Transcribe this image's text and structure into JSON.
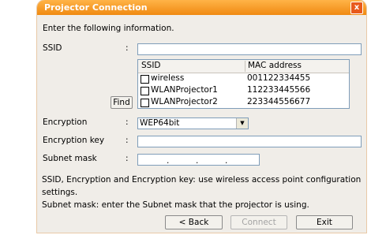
{
  "window": {
    "title": "Projector Connection",
    "close_glyph": "x"
  },
  "instruction": "Enter the following information.",
  "ssid": {
    "label": "SSID",
    "colon": ":",
    "value": ""
  },
  "network_list": {
    "headers": [
      "SSID",
      "MAC address"
    ],
    "rows": [
      {
        "ssid": "wireless",
        "mac": "001122334455",
        "checked": false
      },
      {
        "ssid": "WLANProjector1",
        "mac": "112233445566",
        "checked": false
      },
      {
        "ssid": "WLANProjector2",
        "mac": "223344556677",
        "checked": false
      }
    ]
  },
  "find_button": "Find",
  "encryption": {
    "label": "Encryption",
    "colon": ":",
    "value": "WEP64bit"
  },
  "encryption_key": {
    "label": "Encryption key",
    "colon": ":",
    "value": ""
  },
  "subnet_mask": {
    "label": "Subnet mask",
    "colon": ":",
    "dots": [
      ".",
      ".",
      "."
    ]
  },
  "notes": {
    "line1": "SSID, Encryption and Encryption key: use wireless access point configuration",
    "line2": "settings.",
    "line3": "Subnet mask: enter the Subnet mask that the projector is using."
  },
  "buttons": {
    "back": "< Back",
    "connect": "Connect",
    "exit": "Exit"
  },
  "colors": {
    "titlebar": "#f08a12",
    "window_bg": "#f0ede8",
    "field_border": "#7f9db9"
  }
}
